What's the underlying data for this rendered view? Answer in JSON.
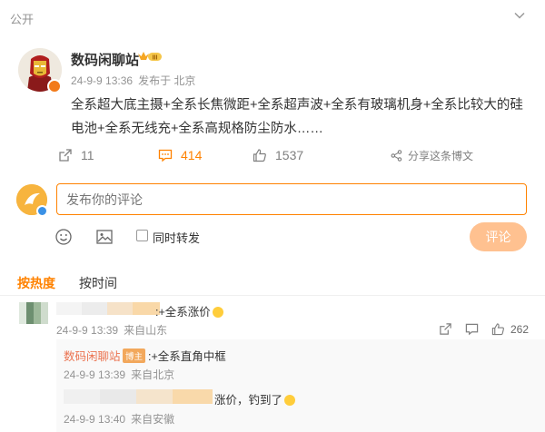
{
  "header": {
    "visibility": "公开",
    "more_icon": "chevron-down-icon"
  },
  "post": {
    "author": "数码闲聊站",
    "badge_text": "III",
    "timestamp": "24-9-9 13:36",
    "source": "发布于 北京",
    "text": "全系超大底主摄+全系长焦微距+全系超声波+全系有玻璃机身+全系比较大的硅电池+全系无线充+全系高规格防尘防水……",
    "repost_count": "11",
    "comment_count": "414",
    "like_count": "1537",
    "share_label": "分享这条博文"
  },
  "composer": {
    "placeholder": "发布你的评论",
    "repost_checkbox_label": "同时转发",
    "submit_label": "评论",
    "icons": [
      "emoji-icon",
      "image-icon"
    ]
  },
  "sort": {
    "hot_label": "按热度",
    "time_label": "按时间"
  },
  "comments": [
    {
      "text": ":+全系涨价",
      "timestamp": "24-9-9 13:39",
      "location": "来自山东",
      "like_count": "262",
      "replies": [
        {
          "author": "数码闲聊站",
          "tag": "博主",
          "text": ":+全系直角中框",
          "timestamp": "24-9-9 13:39",
          "location": "来自北京"
        },
        {
          "text": "涨价，钓到了",
          "timestamp": "24-9-9 13:40",
          "location": "来自安徽"
        }
      ]
    }
  ],
  "colors": {
    "accent": "#ff8200",
    "muted": "#939393",
    "reply_author": "#eb7350",
    "submit_disabled": "#ffc190"
  }
}
